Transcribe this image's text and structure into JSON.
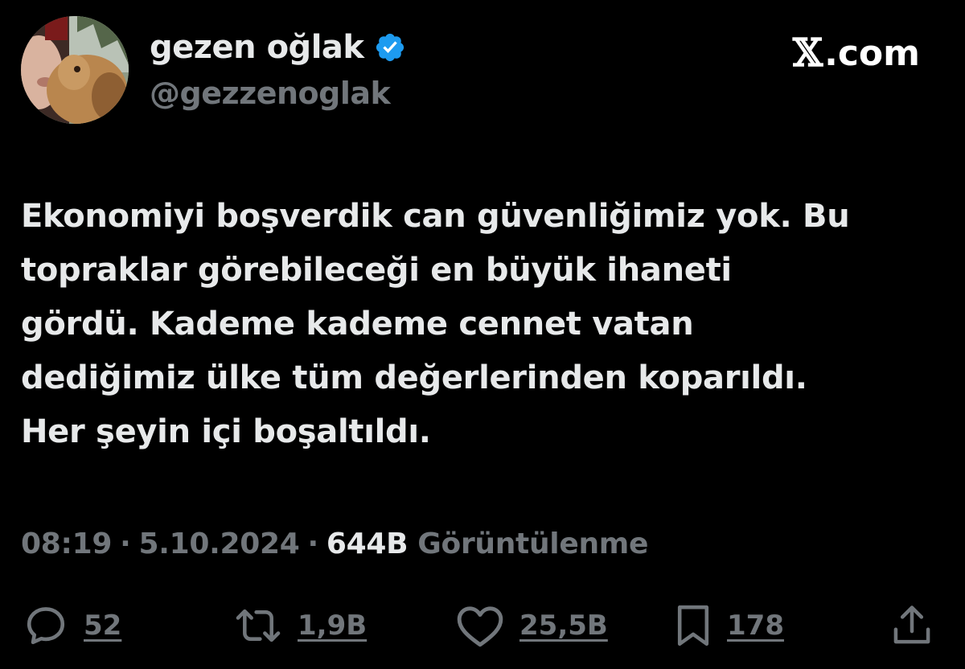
{
  "author": {
    "display_name": "gezen oğlak",
    "handle": "@gezzenoglak",
    "verified_icon": "verified-badge-icon"
  },
  "brand": {
    "x": "𝕏",
    "suffix": ".com"
  },
  "tweet": {
    "lines": [
      "Ekonomiyi boşverdik can güvenliğimiz yok. Bu",
      "topraklar görebileceği en büyük ihaneti",
      "gördü. Kademe kademe cennet vatan",
      "dediğimiz ülke tüm değerlerinden koparıldı.",
      "Her şeyin içi boşaltıldı."
    ]
  },
  "meta": {
    "time": "08:19",
    "date": "5.10.2024",
    "separator": "·",
    "views_count": "644B",
    "views_label": "Görüntülenme"
  },
  "actions": {
    "reply": {
      "icon": "reply-icon",
      "count": "52"
    },
    "repost": {
      "icon": "repost-icon",
      "count": "1,9B"
    },
    "like": {
      "icon": "heart-icon",
      "count": "25,5B"
    },
    "bookmark": {
      "icon": "bookmark-icon",
      "count": "178"
    },
    "share": {
      "icon": "share-icon"
    }
  },
  "colors": {
    "background": "#000000",
    "primary_text": "#e7e9ea",
    "secondary_text": "#71767b",
    "verified_blue": "#1d9bf0"
  }
}
